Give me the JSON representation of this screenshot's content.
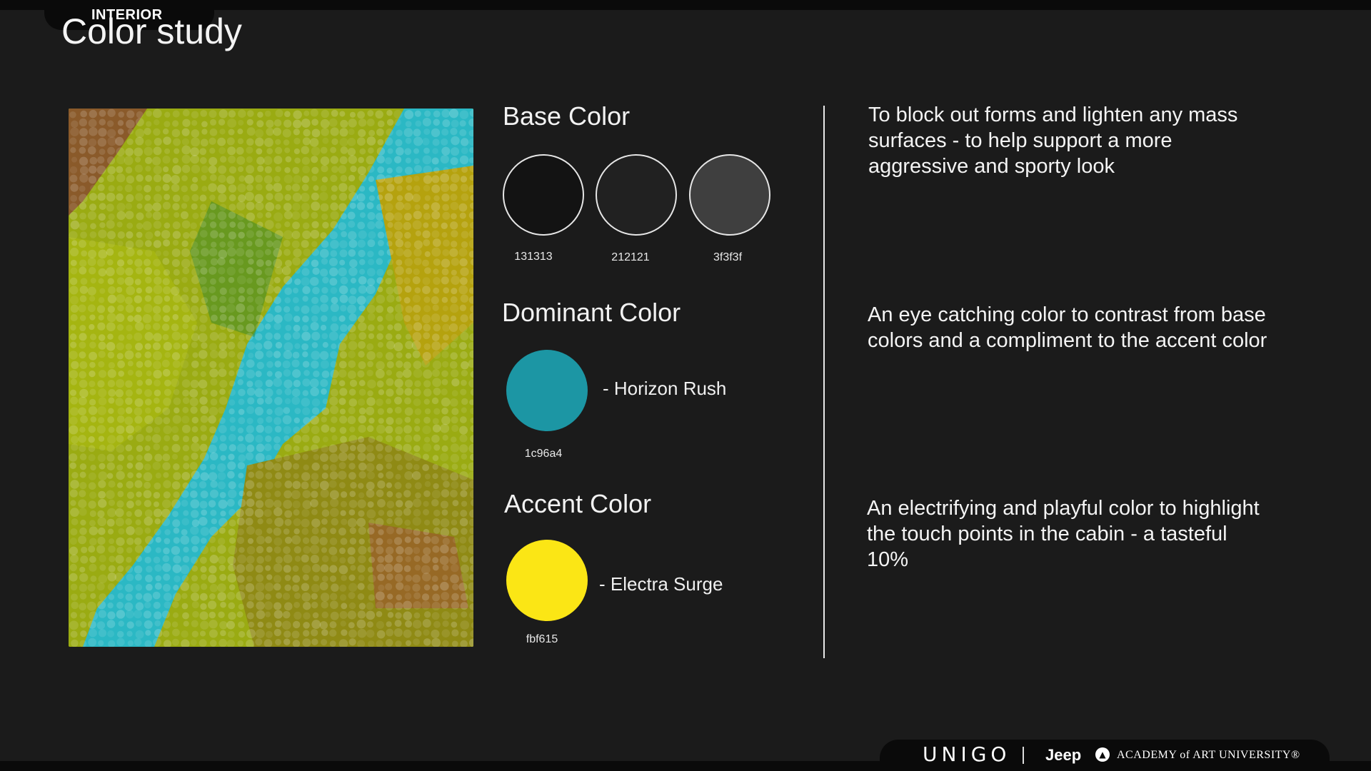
{
  "header": {
    "section_label": "INTERIOR",
    "title": "Color study"
  },
  "image": {
    "icon": "reptile-scale-texture"
  },
  "palette": {
    "base": {
      "title": "Base Color",
      "swatches": [
        {
          "hex": "131313",
          "color": "#131313"
        },
        {
          "hex": "212121",
          "color": "#212121"
        },
        {
          "hex": "3f3f3f",
          "color": "#3f3f3f"
        }
      ],
      "description": "To block out forms and lighten any mass surfaces - to help support a more aggressive and sporty look"
    },
    "dominant": {
      "title": "Dominant Color",
      "hex": "1c96a4",
      "color": "#1c96a4",
      "name": "- Horizon Rush",
      "description": "An eye catching color to contrast from base colors and a compliment to the accent color"
    },
    "accent": {
      "title": "Accent Color",
      "hex": "fbf615",
      "color": "#fbe615",
      "name": "- Electra Surge",
      "description": "An electrifying and playful color to highlight the touch points in the cabin - a tasteful 10%"
    }
  },
  "footer": {
    "logo_unigo": "UNIGO",
    "logo_jeep": "Jeep",
    "aau_icon": "▲",
    "logo_aau": "ACADEMY of ART UNIVERSITY®"
  }
}
